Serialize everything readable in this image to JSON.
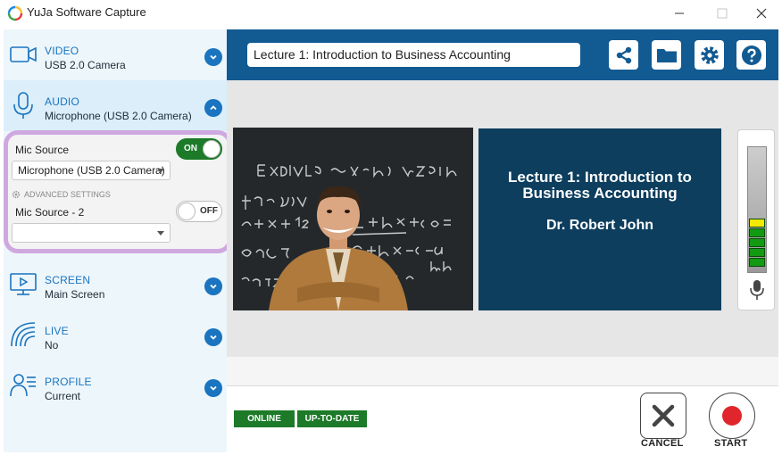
{
  "window": {
    "title": "YuJa Software Capture"
  },
  "sidebar": {
    "video": {
      "title": "VIDEO",
      "value": "USB 2.0 Camera"
    },
    "audio": {
      "title": "AUDIO",
      "value": "Microphone (USB 2.0 Camera)"
    },
    "screen": {
      "title": "SCREEN",
      "value": "Main Screen"
    },
    "live": {
      "title": "LIVE",
      "value": "No"
    },
    "profile": {
      "title": "PROFILE",
      "value": "Current"
    }
  },
  "audio_panel": {
    "mic1_label": "Mic Source",
    "mic1_toggle": "ON",
    "mic1_device": "Microphone (USB 2.0 Camera)",
    "advanced": "ADVANCED SETTINGS",
    "mic2_label": "Mic Source - 2",
    "mic2_toggle": "OFF",
    "mic2_device": ""
  },
  "topbar": {
    "session_title": "Lecture 1: Introduction to Business Accounting"
  },
  "slide": {
    "title": "Lecture 1: Introduction to Business Accounting",
    "author": "Dr. Robert John"
  },
  "status": {
    "online": "ONLINE",
    "update": "UP-TO-DATE"
  },
  "actions": {
    "cancel": "CANCEL",
    "start": "START"
  },
  "colors": {
    "accent": "#1a74bf",
    "topbar": "#125a92",
    "slide_bg": "#0d3e5e",
    "status_green": "#1c7a28",
    "record_red": "#e0262c",
    "highlight_border": "#cfa8e0"
  }
}
